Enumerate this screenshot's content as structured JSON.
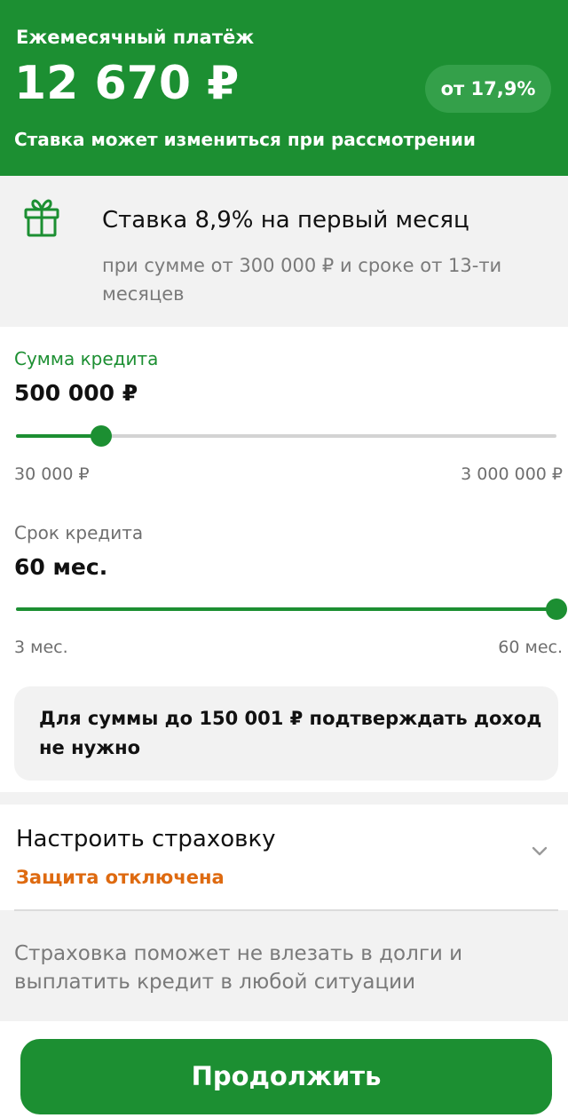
{
  "header": {
    "subtitle": "Ежемесячный платёж",
    "amount": "12 670 ₽",
    "rate_chip": "от 17,9%",
    "note": "Ставка может измениться при рассмотрении"
  },
  "promo": {
    "icon": "gift-icon",
    "title": "Ставка 8,9% на первый месяц",
    "text": "при сумме от  300 000 ₽ и сроке от 13-ти месяцев"
  },
  "loan_amount": {
    "label": "Сумма кредита",
    "value": "500 000 ₽",
    "min_label": "30 000 ₽",
    "max_label": "3 000 000 ₽",
    "slider_fraction": 0.157
  },
  "loan_term": {
    "label": "Срок кредита",
    "value": "60 мес.",
    "min_label": "3 мес.",
    "max_label": "60 мес.",
    "slider_fraction": 1.0
  },
  "income_note": "Для суммы до 150 001 ₽ подтверждать доход не нужно",
  "insurance": {
    "title": "Настроить страховку",
    "status": "Защита отключена",
    "description": "Страховка поможет не влезать в долги и выплатить кредит в любой ситуации"
  },
  "continue_label": "Продолжить",
  "colors": {
    "brand": "#1c8f32",
    "warning": "#de6a10"
  }
}
